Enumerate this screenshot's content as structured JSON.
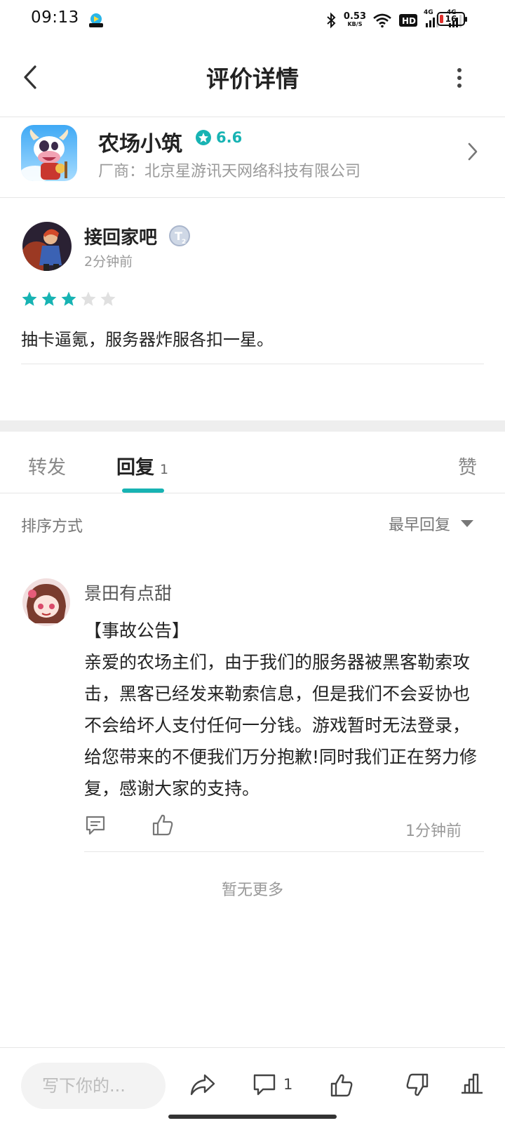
{
  "status_bar": {
    "time": "09:13",
    "net_speed": "0.53",
    "net_unit": "KB/S",
    "hd_label": "HD",
    "signal_1": "4G",
    "signal_2": "4G",
    "battery": "16"
  },
  "header": {
    "title": "评价详情"
  },
  "app": {
    "name": "农场小筑",
    "rating": "6.6",
    "vendor": "厂商：北京星游讯天网络科技有限公司"
  },
  "review": {
    "user": "接回家吧",
    "time": "2分钟前",
    "stars": 3,
    "max_stars": 5,
    "text": "抽卡逼氪，服务器炸服各扣一星。"
  },
  "tabs": {
    "forward": "转发",
    "reply": "回复",
    "reply_count": "1",
    "like": "赞"
  },
  "sort": {
    "label": "排序方式",
    "value": "最早回复"
  },
  "reply": {
    "user": "景田有点甜",
    "text": "【事故公告】\n亲爱的农场主们，由于我们的服务器被黑客勒索攻击，黑客已经发来勒索信息，但是我们不会妥协也不会给坏人支付任何一分钱。游戏暂时无法登录，给您带来的不便我们万分抱歉!同时我们正在努力修复，感谢大家的支持。",
    "time": "1分钟前"
  },
  "no_more": "暂无更多",
  "bottom_bar": {
    "input_placeholder": "写下你的...",
    "comment_count": "1"
  },
  "colors": {
    "accent": "#17b3b3",
    "star_empty": "#e0e0e0"
  }
}
